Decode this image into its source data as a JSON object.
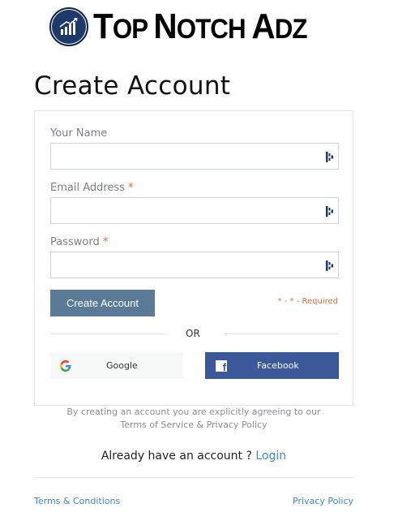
{
  "brand": {
    "name_parts": [
      {
        "big": "T",
        "small": "OP "
      },
      {
        "big": "N",
        "small": "OTCH "
      },
      {
        "big": "A",
        "small": "DZ"
      }
    ],
    "logo_icon": "rising-bar-chart-icon",
    "logo_color": "#1d3a6b"
  },
  "page_title": "Create Account",
  "form": {
    "fields": [
      {
        "label": "Your Name",
        "required": false,
        "value": "",
        "placeholder": "",
        "icon": "password-manager-icon"
      },
      {
        "label": "Email Address",
        "required": true,
        "value": "",
        "placeholder": "",
        "icon": "password-manager-icon"
      },
      {
        "label": "Password",
        "required": true,
        "value": "",
        "placeholder": "",
        "icon": "password-manager-icon"
      }
    ],
    "required_marker": "*",
    "submit_label": "Create Account",
    "required_note": "* - * - Required",
    "or_label": "OR",
    "google_label": "Google",
    "facebook_label": "Facebook"
  },
  "agreement": {
    "line1": "By creating an account you are explicitly agreeing to our",
    "line2": "Terms of Service & Privacy Policy"
  },
  "login_prompt": {
    "text": "Already have an account ? ",
    "link": "Login"
  },
  "footer": {
    "terms": "Terms & Conditions",
    "privacy": "Privacy Policy"
  },
  "colors": {
    "primary_button": "#5b7a98",
    "facebook": "#3b5998",
    "required": "#d9703a",
    "link": "#3f86cc"
  }
}
